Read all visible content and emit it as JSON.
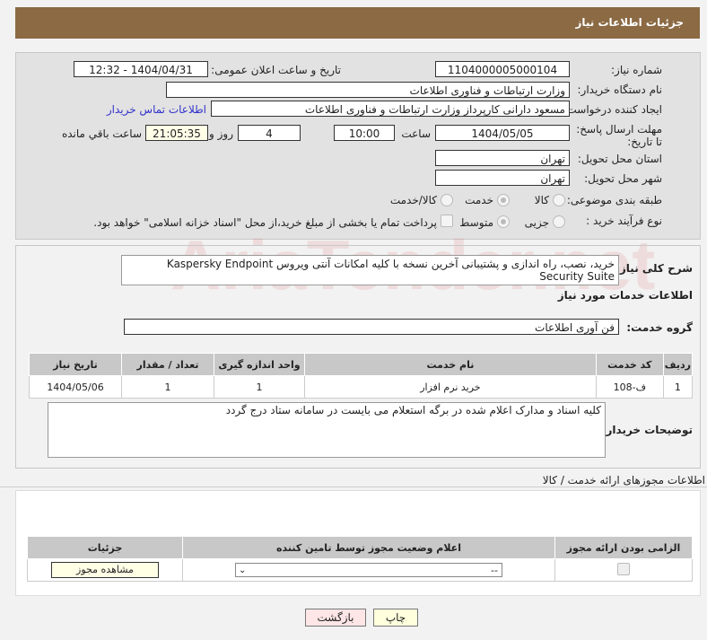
{
  "header": {
    "title": "جزئیات اطلاعات نیاز"
  },
  "fields": {
    "need_number_label": "شماره نیاز:",
    "need_number": "1104000005000104",
    "announce_label": "تاریخ و ساعت اعلان عمومی:",
    "announce_value": "1404/04/31 - 12:32",
    "buyer_org_label": "نام دستگاه خریدار:",
    "buyer_org": "وزارت ارتباطات و فناوری اطلاعات",
    "creator_label": "ایجاد کننده درخواست:",
    "creator": "مسعود دارانی کارپرداز وزارت ارتباطات و فناوری اطلاعات",
    "contact_link": "اطلاعات تماس خریدار",
    "deadline_label": "مهلت ارسال پاسخ: تا تاریخ:",
    "deadline_date": "1404/05/05",
    "time_label": "ساعت",
    "deadline_time": "10:00",
    "days": "4",
    "days_label": "روز و",
    "remaining": "21:05:35",
    "remaining_label": "ساعت باقي مانده",
    "province_label": "استان محل تحویل:",
    "province": "تهران",
    "city_label": "شهر محل تحویل:",
    "city": "تهران",
    "category_label": "طبقه بندی موضوعی:",
    "category_options": [
      "کالا",
      "خدمت",
      "کالا/خدمت"
    ],
    "process_label": "نوع فرآیند خرید :",
    "process_options": [
      "جزیی",
      "متوسط"
    ],
    "payment_note": "پرداخت تمام یا بخشی از مبلغ خرید،از محل \"اسناد خزانه اسلامی\" خواهد بود."
  },
  "details": {
    "desc_label": "شرح کلی نیاز:",
    "desc": "خرید، نصب، راه اندازی و پشتیبانی آخرین نسخه با کلیه امکانات آنتی ویروس  Kaspersky Endpoint Security Suite",
    "services_title": "اطلاعات خدمات مورد نیاز",
    "group_label": "گروه خدمت:",
    "group": "فن آوری اطلاعات",
    "table": {
      "headers": [
        "ردیف",
        "کد خدمت",
        "نام خدمت",
        "واحد اندازه گیری",
        "تعداد / مقدار",
        "تاریخ نیاز"
      ],
      "rows": [
        [
          "1",
          "ف-108",
          "خرید نرم افزار",
          "1",
          "1",
          "1404/05/06"
        ]
      ]
    },
    "buyer_notes_label": "توضیحات خریدار:",
    "buyer_notes": "کلیه اسناد و مدارک اعلام شده در برگه استعلام می بایست در سامانه ستاد درج گردد"
  },
  "permits": {
    "title": "اطلاعات مجوزهای ارائه خدمت / کالا",
    "headers": [
      "الزامی بودن ارائه مجوز",
      "اعلام وضعیت مجوز توسط تامین کننده",
      "جزئیات"
    ],
    "select_value": "--",
    "view_button": "مشاهده مجوز"
  },
  "buttons": {
    "print": "چاپ",
    "back": "بازگشت"
  },
  "watermark": "AriaTender.net"
}
